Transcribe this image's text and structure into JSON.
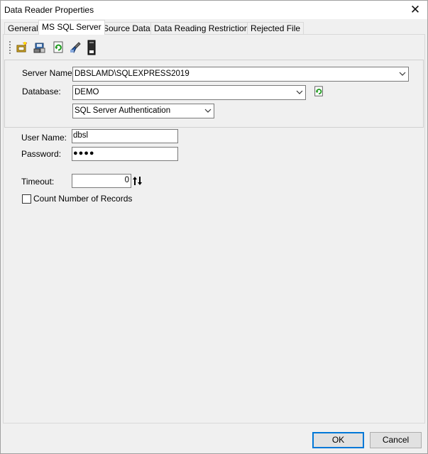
{
  "window": {
    "title": "Data Reader Properties"
  },
  "tabs": [
    {
      "label": "General"
    },
    {
      "label": "MS SQL Server"
    },
    {
      "label": "Source Data"
    },
    {
      "label": "Data Reading Restrictions"
    },
    {
      "label": "Rejected File"
    }
  ],
  "toolbar": {
    "icons": [
      "connection-wizard-icon",
      "save-connection-icon",
      "refresh-icon",
      "clear-icon",
      "sql-file-icon"
    ]
  },
  "connection": {
    "server_label": "Server Name:",
    "server_value": "DBSLAMD\\SQLEXPRESS2019",
    "database_label": "Database:",
    "database_value": "DEMO",
    "auth_value": "SQL Server Authentication"
  },
  "credentials": {
    "user_label": "User Name:",
    "user_value": "dbsl",
    "password_label": "Password:",
    "password_value": "●●●●"
  },
  "timeout": {
    "label": "Timeout:",
    "value": "0"
  },
  "count_records": {
    "label": "Count Number of Records",
    "checked": false
  },
  "buttons": {
    "ok": "OK",
    "cancel": "Cancel"
  }
}
